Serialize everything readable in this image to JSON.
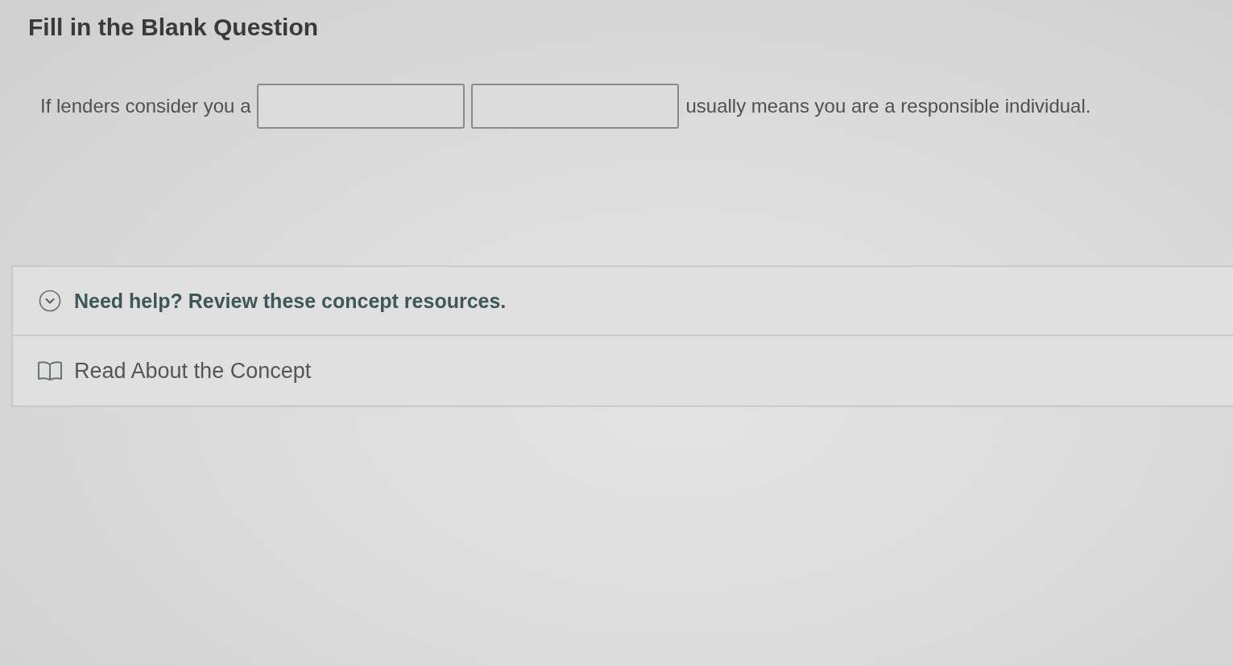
{
  "title": "Fill in the Blank Question",
  "question": {
    "segments": [
      {
        "kind": "text",
        "text": "If lenders consider you a"
      },
      {
        "kind": "blank"
      },
      {
        "kind": "blank"
      },
      {
        "kind": "text",
        "text": "usually means you are a responsible individual."
      }
    ]
  },
  "help": {
    "expanded": true,
    "heading": "Need help? Review these concept resources.",
    "resources": [
      {
        "label": "Read About the Concept"
      }
    ]
  }
}
